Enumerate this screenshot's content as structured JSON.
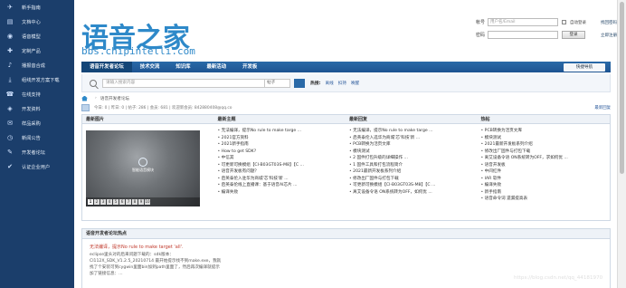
{
  "sidebar": {
    "items": [
      {
        "label": "新手指南",
        "icon": "✈"
      },
      {
        "label": "文档中心",
        "icon": "▤"
      },
      {
        "label": "语音模型",
        "icon": "◉"
      },
      {
        "label": "定制产品",
        "icon": "✚"
      },
      {
        "label": "播报音合成",
        "icon": "♪"
      },
      {
        "label": "组线开发方案下载",
        "icon": "⤓"
      },
      {
        "label": "在线支持",
        "icon": "☎"
      },
      {
        "label": "开发资料",
        "icon": "◈"
      },
      {
        "label": "样品采购",
        "icon": "✉"
      },
      {
        "label": "新闻公告",
        "icon": "◷"
      },
      {
        "label": "开发者论坛",
        "icon": "✎"
      },
      {
        "label": "认证企业用户",
        "icon": "✔"
      }
    ]
  },
  "header": {
    "logo_cn": "语音之家",
    "logo_en": "bbs.chipintelli.com"
  },
  "login": {
    "account_label": "帐号",
    "account_placeholder": "用户名/Email",
    "auto_login": "自动登录",
    "forgot": "找回密码",
    "password_label": "密码",
    "login_button": "登录",
    "register": "立即注册"
  },
  "nav": {
    "tabs": [
      "语音开发者论坛",
      "技术交流",
      "知识库",
      "最新活动",
      "开发板"
    ],
    "quick": "快捷导航"
  },
  "search": {
    "placeholder": "请输入搜索内容",
    "scope": "帖子",
    "hot_label": "热搜:",
    "hot_links": [
      "离线",
      "扣持",
      "唤醒"
    ]
  },
  "breadcrumb": {
    "current": "语音开发者论坛"
  },
  "stats": {
    "text": "今日: 0 | 昨日: 0 | 帖子: 286 | 会员: 681 | 欢迎新会员: 842880408@qq.co",
    "latest": "最新回复"
  },
  "portal": {
    "headers": [
      "最新图片",
      "最新主题",
      "最新回复",
      "热帖"
    ],
    "image_badge": "智能语音模块",
    "pager": [
      "1",
      "2",
      "3",
      "4",
      "5",
      "6",
      "7",
      "8",
      "9",
      "10"
    ],
    "latest_topics": [
      "无法编译，提示No rule to make targe ...",
      "2021官方资料",
      "2021新手指南",
      "How to get SDK?",
      "中信其",
      "可更新可换模组【CI-B03GT03S-M8】【C ...",
      "语音开发板有问题？",
      "启英泰伦入驻华为商城'芯'科技'新 ...",
      "启英泰伦线上直播课：基于语音AI芯片 ...",
      "编译失败"
    ],
    "latest_replies": [
      "无法编译，提示No rule to make targe ...",
      "启英泰伦入选华为商城'芯'科技'新 ...",
      "PCB转换为活页文库",
      "模块测试",
      "2 固件打包升级的详细操作 ...",
      "1 固件工具和打包流程简介",
      "2021最新开发板系列介绍",
      "修改出厂固件与打包下载",
      "可更新可换模组【CI-B03GT03S-M8】【C ...",
      "离艾设备令语 ON系统转为OFF，如何优 ..."
    ],
    "hot_posts": [
      "PCB转换为活页文库",
      "模块测试",
      "2021最新开发板系列介绍",
      "修改出厂固件与打包下载",
      "离艾设备令语 ON系统转为OFF，求如何优 ...",
      "语音开发板",
      "中间红件",
      "IAR 软件",
      "编译失败",
      "新手指南",
      "语音命令词 遗漏提高表"
    ]
  },
  "thread": {
    "header": "语音开发者论坛热点",
    "title": "无法编译，提示No rule to make target 'all'.",
    "lines": [
      "eclipse里头对的后来问题下载的：sdk版本：",
      "CI112X_SDK_V1.2.5_20210714 最开始提示找不到make.exe，我就",
      "找了个安装可到cygwin里面bin加到path里面了，然后再次编译就提示",
      "加了链接信息：..."
    ]
  },
  "watermark": "https://blog.csdn.net/qq_44181970"
}
